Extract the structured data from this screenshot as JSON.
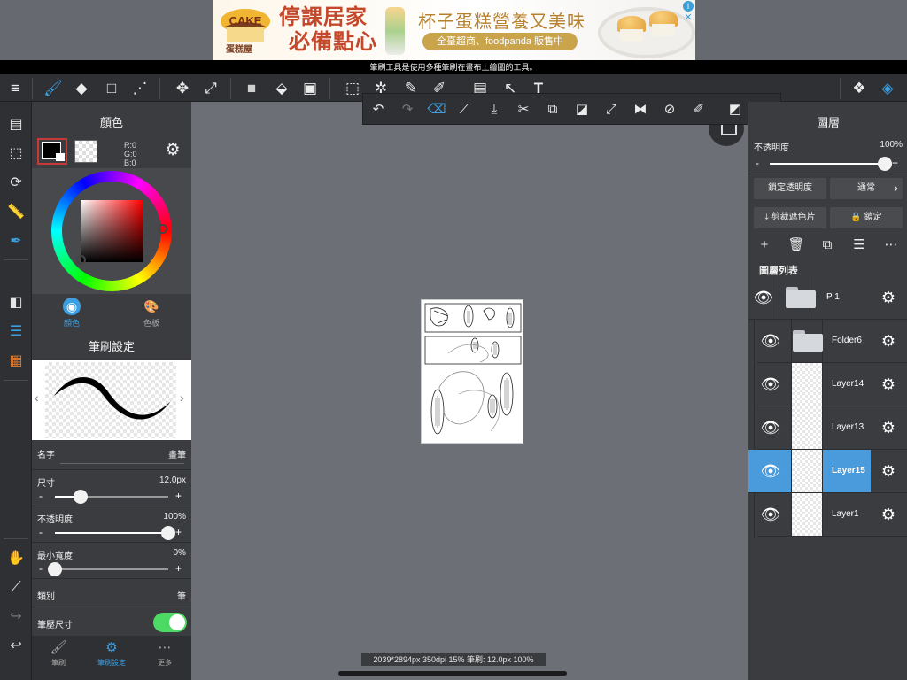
{
  "ad": {
    "brand_top": "CAKE",
    "brand_name": "蛋糕屋",
    "headline_1": "停課居家",
    "headline_2": "必備點心",
    "tagline": "杯子蛋糕營養又美味",
    "pill": "全臺超商、foodpanda 販售中",
    "info_glyph": "i",
    "close_glyph": "✕"
  },
  "tooltip": "筆刷工具是使用多種筆刷在畫布上繪圖的工具。",
  "toolbar": {
    "items": [
      {
        "icon": "menu-icon",
        "glyph": "≡"
      },
      {
        "icon": "brush-tool-icon",
        "glyph": "🖌"
      },
      {
        "icon": "eraser-tool-icon",
        "glyph": "◆"
      },
      {
        "icon": "rectangle-select-icon",
        "glyph": "□"
      },
      {
        "icon": "vector-edit-icon",
        "glyph": "⋰"
      },
      {
        "icon": "move-icon",
        "glyph": "✥"
      },
      {
        "icon": "transform-icon",
        "glyph": "⤢"
      },
      {
        "icon": "fill-square-icon",
        "glyph": "■"
      },
      {
        "icon": "bucket-fill-icon",
        "glyph": "⬙"
      },
      {
        "icon": "gradient-icon",
        "glyph": "▣"
      },
      {
        "icon": "marquee-select-icon",
        "glyph": "⬚"
      },
      {
        "icon": "magic-wand-icon",
        "glyph": "✲"
      },
      {
        "icon": "select-pen-icon",
        "glyph": "✎"
      },
      {
        "icon": "select-eraser-icon",
        "glyph": "✐"
      },
      {
        "icon": "frame-divide-icon",
        "glyph": "▤"
      },
      {
        "icon": "operation-icon",
        "glyph": "↖"
      },
      {
        "icon": "text-tool-icon",
        "glyph": "T"
      },
      {
        "icon": "materials-icon",
        "glyph": "❖"
      },
      {
        "icon": "layers-icon",
        "glyph": "◈"
      }
    ]
  },
  "leftbar": {
    "items": [
      {
        "icon": "pages-icon",
        "glyph": "▤"
      },
      {
        "icon": "selection-icon",
        "glyph": "⬚"
      },
      {
        "icon": "rotate-icon",
        "glyph": "⟳"
      },
      {
        "icon": "ruler-icon",
        "glyph": "📏"
      },
      {
        "icon": "snap-pen-icon",
        "glyph": "✒"
      },
      {
        "icon": "color-swatch-icon",
        "glyph": "◧"
      },
      {
        "icon": "layer-list-icon",
        "glyph": "☰"
      },
      {
        "icon": "palette-stack-icon",
        "glyph": "▦"
      },
      {
        "icon": "hand-icon",
        "glyph": "✋"
      },
      {
        "icon": "eyedropper-icon",
        "glyph": "⟋"
      },
      {
        "icon": "redo-icon",
        "glyph": "↪"
      },
      {
        "icon": "undo-icon",
        "glyph": "↩"
      }
    ]
  },
  "color_panel": {
    "title": "顏色",
    "r": "R:0",
    "g": "G:0",
    "b": "B:0",
    "tab_color": "顏色",
    "tab_palette": "色板",
    "gear_glyph": "⚙",
    "tab_color_glyph": "◉",
    "tab_palette_glyph": "🎨"
  },
  "brush_panel": {
    "title": "筆刷設定",
    "prev_glyph": "‹",
    "next_glyph": "›",
    "name_label": "名字",
    "name_value": "畫筆",
    "size_label": "尺寸",
    "size_value": "12.0px",
    "opacity_label": "不透明度",
    "opacity_value": "100%",
    "min_width_label": "最小寬度",
    "min_width_value": "0%",
    "type_label": "類別",
    "type_value": "筆",
    "pressure_label": "筆壓尺寸",
    "minus": "-",
    "plus": "+",
    "size_level": 0.23,
    "opacity_level": 1.0,
    "min_width_level": 0.0
  },
  "bottom_tabs": [
    {
      "label": "筆刷",
      "glyph": "🖌"
    },
    {
      "label": "筆刷設定",
      "glyph": "⚙"
    },
    {
      "label": "更多",
      "glyph": "⋯"
    }
  ],
  "selection_toolbar": {
    "items": [
      {
        "icon": "undo-icon",
        "glyph": "↶"
      },
      {
        "icon": "redo-icon",
        "glyph": "↷"
      },
      {
        "icon": "clear-icon",
        "glyph": "⌫"
      },
      {
        "icon": "eyedropper-icon",
        "glyph": "⟋"
      },
      {
        "icon": "download-icon",
        "glyph": "⤓"
      },
      {
        "icon": "cut-icon",
        "glyph": "✂"
      },
      {
        "icon": "copy-icon",
        "glyph": "⧉"
      },
      {
        "icon": "deselect-icon",
        "glyph": "◪"
      },
      {
        "icon": "transform-icon",
        "glyph": "⤢"
      },
      {
        "icon": "flip-icon",
        "glyph": "⧓"
      },
      {
        "icon": "rotate-off-icon",
        "glyph": "⊘"
      },
      {
        "icon": "eraser-icon",
        "glyph": "✐"
      },
      {
        "icon": "edit-icon",
        "glyph": "◩"
      },
      {
        "icon": "grip-icon",
        "glyph": "⠿"
      }
    ]
  },
  "status_bar": "2039*2894px 350dpi 15% 筆刷: 12.0px 100%",
  "layer_panel": {
    "title": "圖層",
    "opacity_label": "不透明度",
    "opacity_value": "100%",
    "opacity_level": 1.0,
    "lock_alpha": "鎖定透明度",
    "blend_mode": "通常",
    "clipping": "剪裁遮色片",
    "lock": "鎖定",
    "list_title": "圖層列表",
    "minus": "-",
    "plus": "+",
    "more_glyph": "›",
    "icons": [
      {
        "icon": "add-layer-icon",
        "glyph": "+"
      },
      {
        "icon": "delete-layer-icon",
        "glyph": "🗑"
      },
      {
        "icon": "duplicate-layer-icon",
        "glyph": "⧉"
      },
      {
        "icon": "layer-menu-icon",
        "glyph": "☰"
      },
      {
        "icon": "more-icon",
        "glyph": "⋯"
      }
    ],
    "layers": [
      {
        "name": "P 1",
        "type": "folder",
        "level": 0
      },
      {
        "name": "Folder6",
        "type": "folder",
        "level": 1
      },
      {
        "name": "Layer14",
        "type": "layer",
        "level": 1
      },
      {
        "name": "Layer13",
        "type": "layer",
        "level": 1
      },
      {
        "name": "Layer15",
        "type": "layer",
        "level": 1,
        "selected": true
      },
      {
        "name": "Layer1",
        "type": "layer",
        "level": 1
      }
    ]
  }
}
